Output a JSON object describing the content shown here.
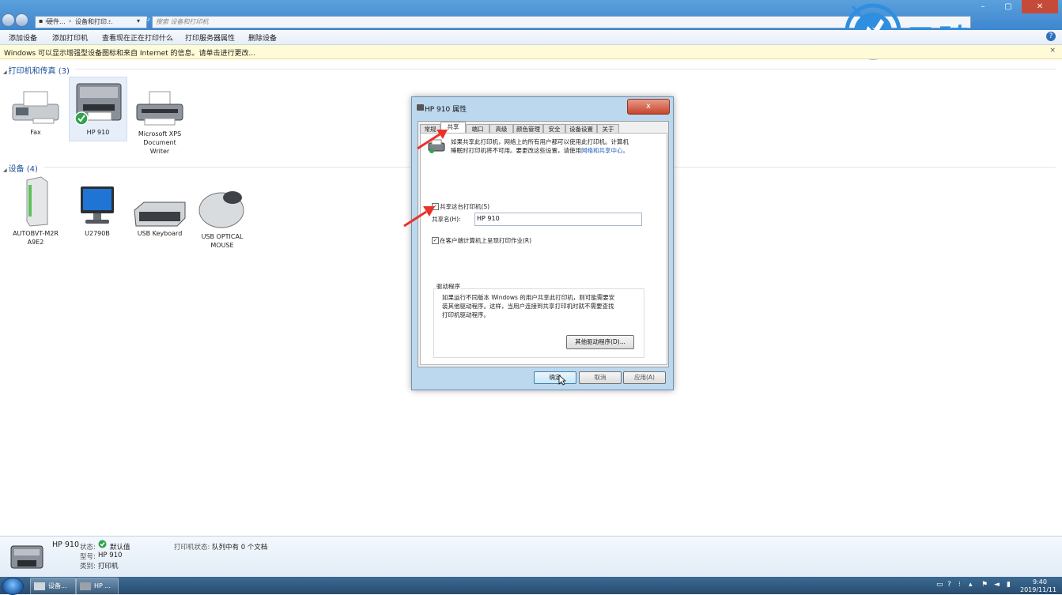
{
  "window": {
    "breadcrumb": [
      "硬件...",
      "设备和打印...",
      ""
    ],
    "search_placeholder": "搜索 设备和打印机",
    "min": "–",
    "max": "▢",
    "close": "✕"
  },
  "toolbar": {
    "items": [
      "添加设备",
      "添加打印机",
      "查看现在正在打印什么",
      "打印服务器属性",
      "删除设备"
    ],
    "help": "?"
  },
  "infobar": {
    "text": "Windows 可以显示增强型设备图标和来自 Internet 的信息。请单击进行更改...",
    "close": "×"
  },
  "printers_section": {
    "header": "打印机和传真 (3)",
    "items": [
      {
        "label": "Fax",
        "icon": "fax-icon"
      },
      {
        "label": "HP 910",
        "icon": "printer-icon",
        "default": true
      },
      {
        "label_lines": [
          "Microsoft XPS",
          "Document",
          "Writer"
        ],
        "icon": "xps-printer-icon"
      }
    ]
  },
  "devices_section": {
    "header": "设备 (4)",
    "items": [
      {
        "label_lines": [
          "AUTOBVT-M2R",
          "A9E2"
        ],
        "icon": "computer-tower-icon"
      },
      {
        "label": "U2790B",
        "icon": "monitor-icon"
      },
      {
        "label": "USB Keyboard",
        "icon": "keyboard-icon"
      },
      {
        "label_lines": [
          "USB OPTICAL",
          "MOUSE"
        ],
        "icon": "mouse-icon"
      }
    ]
  },
  "watermark": {
    "text": "云骑士"
  },
  "dialog": {
    "title": "HP 910 属性",
    "close": "x",
    "tabs": [
      "常规",
      "共享",
      "端口",
      "高级",
      "颜色管理",
      "安全",
      "设备设置",
      "关于"
    ],
    "active_tab": "共享",
    "intro_line1": "如果共享此打印机，网络上的所有用户都可以使用此打印机。计算机",
    "intro_line2_prefix": "睡眠时打印机将不可用。要更改这些设置，请使用",
    "intro_link": "网络和共享中心。",
    "share_checkbox": "共享这台打印机(S)",
    "share_checked": true,
    "share_name_label": "共享名(H):",
    "share_name_value": "HP 910",
    "render_checkbox": "在客户端计算机上呈现打印作业(R)",
    "render_checked": true,
    "drivers_heading": "驱动程序",
    "drivers_text": [
      "如果运行不同版本 Windows 的用户共享此打印机，则可能需要安",
      "装其他驱动程序。这样，当用户连接到共享打印机时就不需要查找",
      "打印机驱动程序。"
    ],
    "other_drivers_button": "其他驱动程序(D)...",
    "ok": "确定",
    "cancel": "取消",
    "apply": "应用(A)"
  },
  "details": {
    "name": "HP 910",
    "status_key": "状态:",
    "status_value": "默认值",
    "model_key": "型号:",
    "model_value": "HP 910",
    "category_key": "类别:",
    "category_value": "打印机",
    "printer_status_key": "打印机状态:",
    "printer_status_value": "队列中有 0 个文档"
  },
  "taskbar": {
    "tasks": [
      "设备...",
      "HP ..."
    ],
    "time": "9:40",
    "date": "2019/11/11"
  },
  "colors": {
    "accent_blue": "#3e86cf",
    "close_red": "#c7452e",
    "arrow_red": "#e8322b",
    "section_blue": "#1b4f9c",
    "watermark_blue": "#2e8fe0"
  }
}
